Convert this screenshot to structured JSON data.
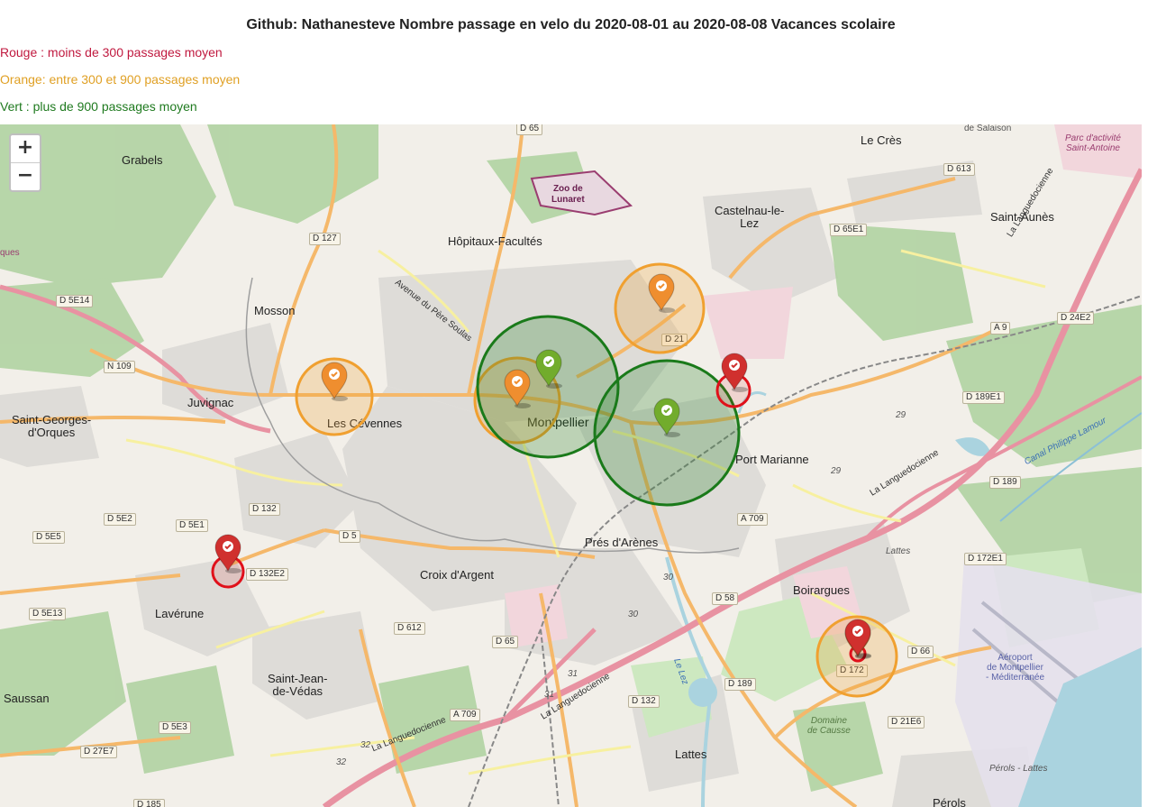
{
  "title": "Github: Nathanesteve Nombre passage en velo du 2020-08-01 au 2020-08-08 Vacances scolaire",
  "legend": {
    "red": {
      "text": "Rouge : moins de 300 passages moyen",
      "color": "#c0193f"
    },
    "orange": {
      "text": "Orange: entre 300 et 900 passages moyen",
      "color": "#e0a024"
    },
    "green": {
      "text": "Vert : plus de 900 passages moyen",
      "color": "#1f7a1f"
    }
  },
  "zoom": {
    "in": "+",
    "out": "−"
  },
  "marker_icon": "check-icon",
  "markers": [
    {
      "category": "orange",
      "color": "#f0a030",
      "pin_color": "#ef8e2f"
    },
    {
      "category": "orange",
      "color": "#f0a030",
      "pin_color": "#ef8e2f"
    },
    {
      "category": "orange",
      "color": "#f0a030",
      "pin_color": "#ef8e2f"
    },
    {
      "category": "orange",
      "color": "#f0a030",
      "pin_color": "#ef8e2f"
    },
    {
      "category": "green",
      "color": "#1a7a1a",
      "pin_color": "#72ac2c"
    },
    {
      "category": "green",
      "color": "#1a7a1a",
      "pin_color": "#72ac2c"
    },
    {
      "category": "red",
      "color": "#e0101a",
      "pin_color": "#d0302e"
    },
    {
      "category": "red",
      "color": "#e0101a",
      "pin_color": "#d0302e"
    },
    {
      "category": "red",
      "color": "#e0101a",
      "pin_color": "#d0302e"
    }
  ],
  "places": {
    "grabels": "Grabels",
    "le_cres": "Le Crès",
    "castelnau": "Castelnau-le-\nLez",
    "saint_aunes": "Saint-Aunès",
    "hopitaux": "Hôpitaux-Facultés",
    "mosson": "Mosson",
    "juvignac": "Juvignac",
    "saint_georges": "Saint-Georges-\nd'Orques",
    "les_cevennes": "Les Cévennes",
    "montpellier": "Montpellier",
    "port_marianne": "Port Marianne",
    "pres_arenes": "Prés d'Arènes",
    "croix_argent": "Croix d'Argent",
    "boirargues": "Boirargues",
    "laverune": "Lavérune",
    "saint_jean": "Saint-Jean-\nde-Védas",
    "saussan": "Saussan",
    "lattes": "Lattes",
    "lattes_small": "Lattes",
    "perols": "Pérols",
    "perols_lattes": "Pérols - Lattes",
    "zoo": "Zoo de\nLunaret",
    "parc_activite": "Parc d'activité\nSaint-Antoine",
    "aeroport": "Aéroport\nde Montpellier\n- Méditerranée",
    "domaine": "Domaine\nde Causse",
    "pere_soulas": "Avenue du Père Soulas",
    "languedocienne": "La Languedocienne",
    "viendre": "ques",
    "salaison": "de Salaison",
    "canal": "Canal Philippe Lamour",
    "lez": "Le Lez"
  },
  "roads": [
    "D 65",
    "D 613",
    "D 127",
    "D 65E1",
    "D 5E14",
    "N 109",
    "A 9",
    "D 24E2",
    "D 21",
    "D 189E1",
    "D 189",
    "D 5E2",
    "D 5E1",
    "D 132",
    "D 5E5",
    "D 5",
    "D 132E2",
    "A 709",
    "D 172E1",
    "D 58",
    "D 5E13",
    "D 612",
    "D 65",
    "D 66",
    "D 172",
    "D 189",
    "D 132",
    "A 709",
    "D 21E6",
    "D 5E3",
    "D 27E7",
    "D 185"
  ],
  "exit_numbers": [
    "29",
    "29",
    "30",
    "30",
    "31",
    "31",
    "32",
    "32"
  ]
}
